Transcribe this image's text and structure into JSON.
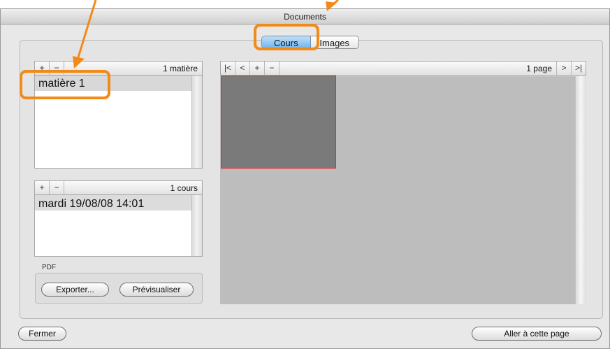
{
  "window": {
    "title": "Documents"
  },
  "tabs": {
    "active": "Cours",
    "inactive": "Images"
  },
  "subjects": {
    "add": "+",
    "remove": "−",
    "count": "1 matière",
    "items": [
      "matière 1"
    ]
  },
  "courses": {
    "add": "+",
    "remove": "−",
    "count": "1 cours",
    "items": [
      "mardi 19/08/08 14:01"
    ]
  },
  "pages_toolbar": {
    "first": "|<",
    "prev": "<",
    "add": "+",
    "remove": "−",
    "count": "1 page",
    "next": ">",
    "last": ">|"
  },
  "pdf": {
    "label": "PDF",
    "export": "Exporter...",
    "preview": "Prévisualiser"
  },
  "footer": {
    "close": "Fermer",
    "goto": "Aller à cette page"
  },
  "colors": {
    "annotation": "#f28a1a",
    "selection_border": "#e03030"
  }
}
